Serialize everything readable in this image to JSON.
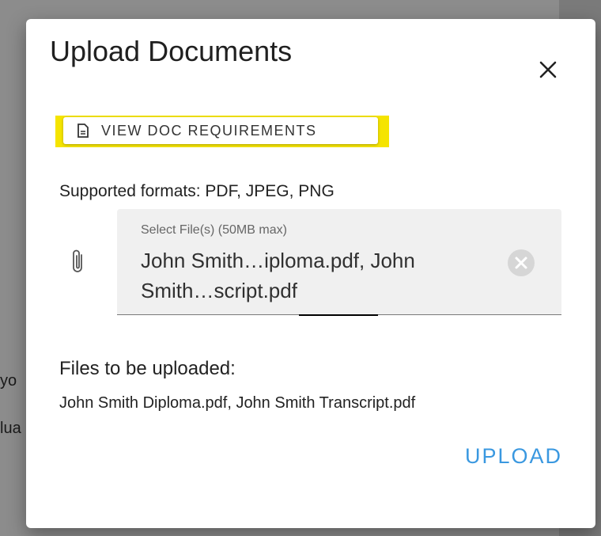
{
  "background": {
    "text_line_1": "yo",
    "text_line_2": "lua"
  },
  "modal": {
    "title": "Upload Documents",
    "close_icon": "close-icon",
    "doc_requirements_button": {
      "label": "VIEW DOC REQUIREMENTS",
      "icon": "document-icon",
      "highlight_color": "#f5e400"
    },
    "supported_formats": "Supported formats: PDF, JPEG, PNG",
    "file_field": {
      "icon": "paperclip-icon",
      "label": "Select File(s) (50MB max)",
      "value": "John Smith…iploma.pdf, John Smith…script.pdf",
      "clear_icon": "clear-circle-icon"
    },
    "files_heading": "Files to be uploaded:",
    "files_list": "John Smith Diploma.pdf, John Smith Transcript.pdf",
    "upload_button": {
      "label": "UPLOAD",
      "color": "#3a98e0"
    }
  }
}
